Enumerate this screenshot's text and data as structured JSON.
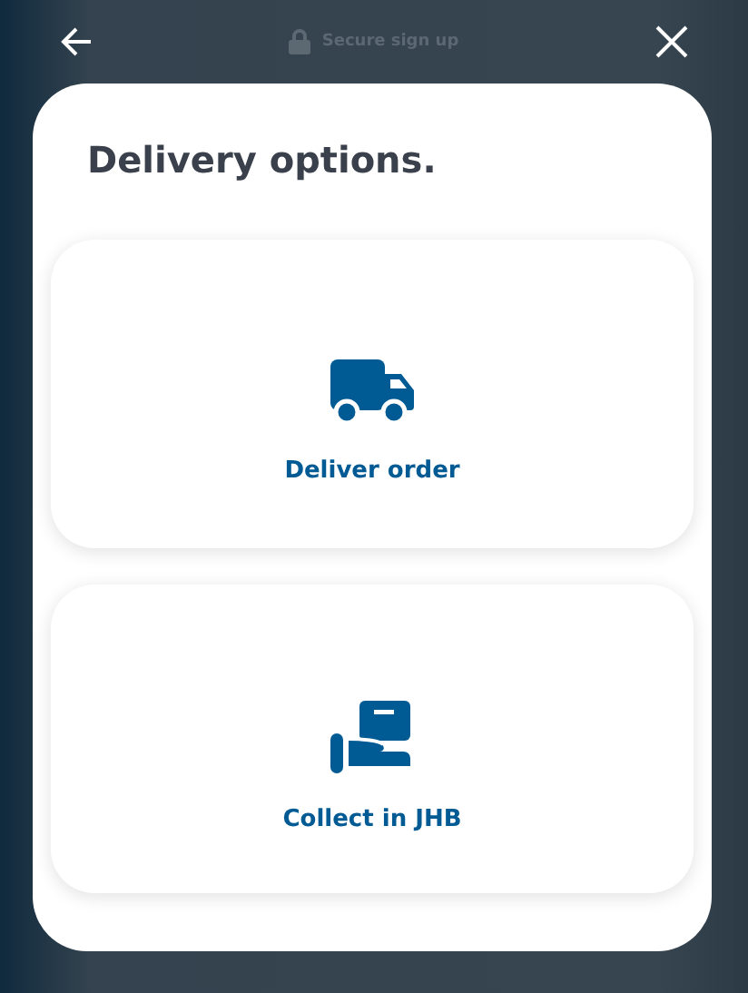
{
  "header": {
    "title": "Secure sign up"
  },
  "modal": {
    "title": "Delivery options."
  },
  "options": [
    {
      "kind": "deliver",
      "label": "Deliver order"
    },
    {
      "kind": "collect",
      "label": "Collect in JHB"
    }
  ]
}
